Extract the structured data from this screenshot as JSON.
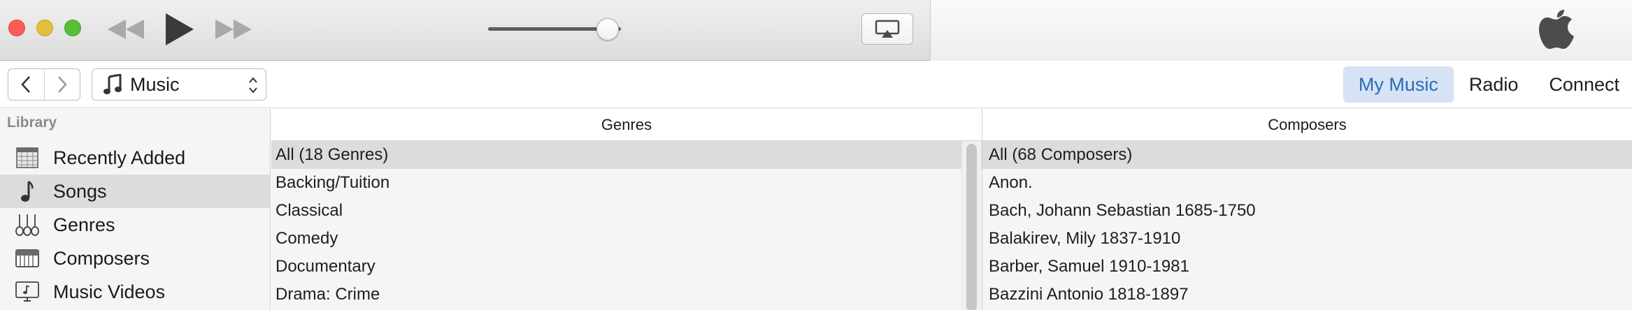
{
  "window": {
    "title_bar_colors": {
      "close": "#fc5b57",
      "minimize": "#e5bf3c",
      "zoom": "#57c038"
    }
  },
  "transport": {
    "rewind_icon": "rewind-icon",
    "play_icon": "play-icon",
    "fast_forward_icon": "fast-forward-icon",
    "volume_level": 0.9,
    "airplay_icon": "airplay-icon",
    "lcd_icon": "apple-logo"
  },
  "navbar": {
    "back_icon": "chevron-left-icon",
    "forward_icon": "chevron-right-icon",
    "media_kind": {
      "selected": "Music",
      "icon": "music-note-icon"
    },
    "tabs": [
      {
        "label": "My Music",
        "active": true
      },
      {
        "label": "Radio",
        "active": false
      },
      {
        "label": "Connect",
        "active": false
      }
    ],
    "accent_color": "#2c6bb7"
  },
  "sidebar": {
    "heading": "Library",
    "items": [
      {
        "label": "Recently Added",
        "icon": "calendar-grid-icon",
        "selected": false
      },
      {
        "label": "Songs",
        "icon": "music-note-icon",
        "selected": true
      },
      {
        "label": "Genres",
        "icon": "guitar-icon",
        "selected": false
      },
      {
        "label": "Composers",
        "icon": "piano-icon",
        "selected": false
      },
      {
        "label": "Music Videos",
        "icon": "video-screen-icon",
        "selected": false
      }
    ]
  },
  "genres": {
    "header": "Genres",
    "rows": [
      {
        "label": "All (18 Genres)",
        "selected": true
      },
      {
        "label": "Backing/Tuition"
      },
      {
        "label": "Classical"
      },
      {
        "label": "Comedy"
      },
      {
        "label": "Documentary"
      },
      {
        "label": "Drama: Crime"
      }
    ]
  },
  "composers": {
    "header": "Composers",
    "rows": [
      {
        "label": "All (68 Composers)",
        "selected": true
      },
      {
        "label": "Anon."
      },
      {
        "label": "Bach, Johann Sebastian 1685-1750"
      },
      {
        "label": "Balakirev, Mily 1837-1910"
      },
      {
        "label": "Barber, Samuel 1910-1981"
      },
      {
        "label": "Bazzini Antonio 1818-1897"
      }
    ]
  }
}
